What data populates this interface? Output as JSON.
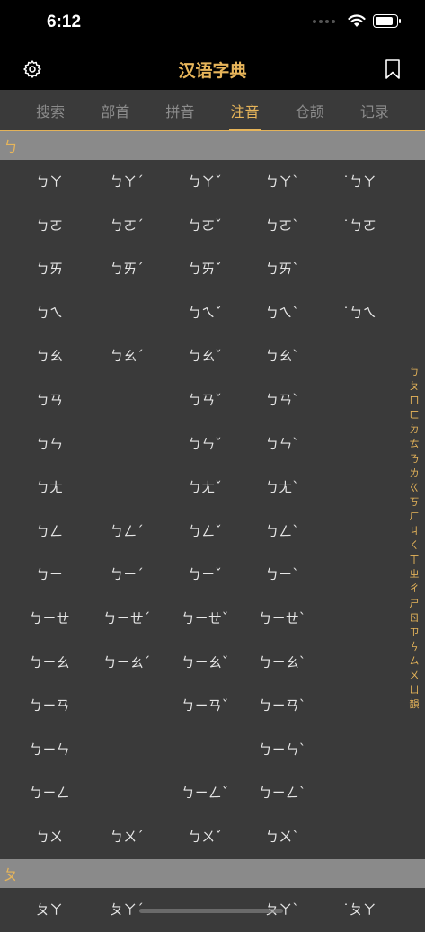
{
  "status": {
    "time": "6:12"
  },
  "nav": {
    "title": "汉语字典"
  },
  "tabs": [
    "搜索",
    "部首",
    "拼音",
    "注音",
    "仓颉",
    "记录"
  ],
  "active_tab": "注音",
  "sections": [
    {
      "header": "ㄅ",
      "rows": [
        [
          "ㄅㄚ",
          "ㄅㄚˊ",
          "ㄅㄚˇ",
          "ㄅㄚˋ",
          "˙ㄅㄚ"
        ],
        [
          "ㄅㄛ",
          "ㄅㄛˊ",
          "ㄅㄛˇ",
          "ㄅㄛˋ",
          "˙ㄅㄛ"
        ],
        [
          "ㄅㄞ",
          "ㄅㄞˊ",
          "ㄅㄞˇ",
          "ㄅㄞˋ",
          ""
        ],
        [
          "ㄅㄟ",
          "",
          "ㄅㄟˇ",
          "ㄅㄟˋ",
          "˙ㄅㄟ"
        ],
        [
          "ㄅㄠ",
          "ㄅㄠˊ",
          "ㄅㄠˇ",
          "ㄅㄠˋ",
          ""
        ],
        [
          "ㄅㄢ",
          "",
          "ㄅㄢˇ",
          "ㄅㄢˋ",
          ""
        ],
        [
          "ㄅㄣ",
          "",
          "ㄅㄣˇ",
          "ㄅㄣˋ",
          ""
        ],
        [
          "ㄅㄤ",
          "",
          "ㄅㄤˇ",
          "ㄅㄤˋ",
          ""
        ],
        [
          "ㄅㄥ",
          "ㄅㄥˊ",
          "ㄅㄥˇ",
          "ㄅㄥˋ",
          ""
        ],
        [
          "ㄅㄧ",
          "ㄅㄧˊ",
          "ㄅㄧˇ",
          "ㄅㄧˋ",
          ""
        ],
        [
          "ㄅㄧㄝ",
          "ㄅㄧㄝˊ",
          "ㄅㄧㄝˇ",
          "ㄅㄧㄝˋ",
          ""
        ],
        [
          "ㄅㄧㄠ",
          "ㄅㄧㄠˊ",
          "ㄅㄧㄠˇ",
          "ㄅㄧㄠˋ",
          ""
        ],
        [
          "ㄅㄧㄢ",
          "",
          "ㄅㄧㄢˇ",
          "ㄅㄧㄢˋ",
          ""
        ],
        [
          "ㄅㄧㄣ",
          "",
          "",
          "ㄅㄧㄣˋ",
          ""
        ],
        [
          "ㄅㄧㄥ",
          "",
          "ㄅㄧㄥˇ",
          "ㄅㄧㄥˋ",
          ""
        ],
        [
          "ㄅㄨ",
          "ㄅㄨˊ",
          "ㄅㄨˇ",
          "ㄅㄨˋ",
          ""
        ]
      ]
    },
    {
      "header": "ㄆ",
      "rows": [
        [
          "ㄆㄚ",
          "ㄆㄚˊ",
          "",
          "ㄆㄚˋ",
          "˙ㄆㄚ"
        ]
      ]
    }
  ],
  "index_letters": [
    "ㄅ",
    "ㄆ",
    "ㄇ",
    "ㄈ",
    "ㄉ",
    "ㄊ",
    "ㄋ",
    "ㄌ",
    "ㄍ",
    "ㄎ",
    "ㄏ",
    "ㄐ",
    "ㄑ",
    "ㄒ",
    "ㄓ",
    "ㄔ",
    "ㄕ",
    "ㄖ",
    "ㄗ",
    "ㄘ",
    "ㄙ",
    "ㄨ",
    "ㄩ",
    "韻"
  ],
  "colors": {
    "accent": "#e7b55a",
    "background": "#3a3a3a",
    "header_bg": "#8a8a8a"
  },
  "icons": {
    "left": "gear-icon",
    "right": "bookmark-icon"
  }
}
